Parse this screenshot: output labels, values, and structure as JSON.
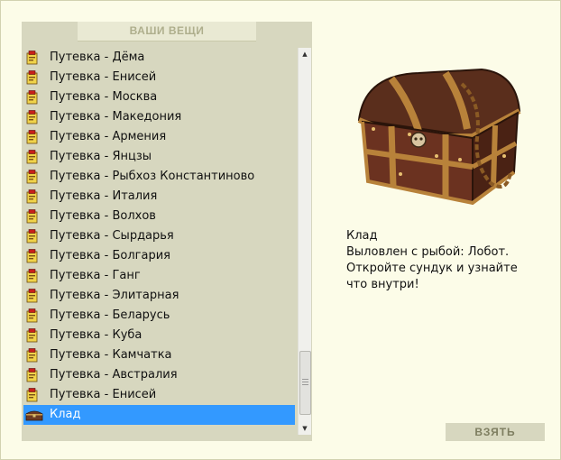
{
  "panel": {
    "title": "ВАШИ ВЕЩИ"
  },
  "items": [
    {
      "label": "Путевка - Дёма",
      "icon": "ticket-icon"
    },
    {
      "label": "Путевка - Енисей",
      "icon": "ticket-icon"
    },
    {
      "label": "Путевка - Москва",
      "icon": "ticket-icon"
    },
    {
      "label": "Путевка - Македония",
      "icon": "ticket-icon"
    },
    {
      "label": "Путевка - Армения",
      "icon": "ticket-icon"
    },
    {
      "label": "Путевка - Янцзы",
      "icon": "ticket-icon"
    },
    {
      "label": "Путевка - Рыбхоз Константиново",
      "icon": "ticket-icon"
    },
    {
      "label": "Путевка - Италия",
      "icon": "ticket-icon"
    },
    {
      "label": "Путевка - Волхов",
      "icon": "ticket-icon"
    },
    {
      "label": "Путевка - Сырдарья",
      "icon": "ticket-icon"
    },
    {
      "label": "Путевка - Болгария",
      "icon": "ticket-icon"
    },
    {
      "label": "Путевка - Ганг",
      "icon": "ticket-icon"
    },
    {
      "label": "Путевка - Элитарная",
      "icon": "ticket-icon"
    },
    {
      "label": "Путевка - Беларусь",
      "icon": "ticket-icon"
    },
    {
      "label": "Путевка - Куба",
      "icon": "ticket-icon"
    },
    {
      "label": "Путевка - Камчатка",
      "icon": "ticket-icon"
    },
    {
      "label": "Путевка - Австралия",
      "icon": "ticket-icon"
    },
    {
      "label": "Путевка - Енисей",
      "icon": "ticket-icon"
    },
    {
      "label": "Клад",
      "icon": "treasure-chest-icon",
      "selected": true
    }
  ],
  "detail": {
    "image": "treasure-chest-image",
    "line1": "Клад",
    "line2": "Выловлен с рыбой: Лобот.",
    "line3": "Откройте сундук и узнайте",
    "line4": "что внутри!"
  },
  "actions": {
    "take_label": "ВЗЯТЬ"
  },
  "colors": {
    "background": "#fcfce8",
    "panel": "#d7d7bf",
    "selection": "#3399ff",
    "header_text": "#aeae8c"
  }
}
